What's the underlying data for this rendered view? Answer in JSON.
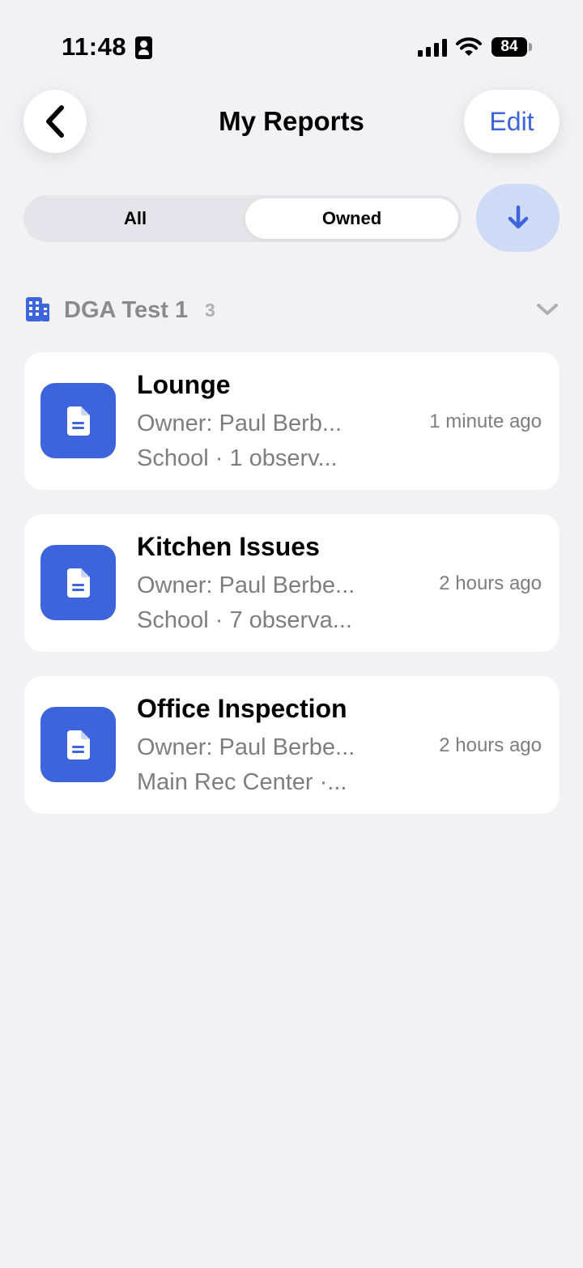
{
  "status_bar": {
    "time": "11:48",
    "battery": "84",
    "icons": [
      "id-card-icon",
      "signal-icon",
      "wifi-icon",
      "battery-icon"
    ]
  },
  "nav": {
    "title": "My Reports",
    "edit_label": "Edit",
    "back_icon": "chevron-left-icon"
  },
  "filter": {
    "segments": [
      {
        "label": "All",
        "selected": false
      },
      {
        "label": "Owned",
        "selected": true
      }
    ],
    "sort_icon": "arrow-down-icon"
  },
  "group": {
    "icon": "building-icon",
    "title": "DGA Test 1",
    "count": "3",
    "chevron": "chevron-down-icon"
  },
  "reports": [
    {
      "title": "Lounge",
      "owner": "Owner: Paul Berb...",
      "meta": "School · 1 observ...",
      "time": "1 minute ago",
      "icon": "document-icon"
    },
    {
      "title": "Kitchen Issues",
      "owner": "Owner: Paul Berbe...",
      "meta": "School · 7 observa...",
      "time": "2 hours ago",
      "icon": "document-icon"
    },
    {
      "title": "Office Inspection",
      "owner": "Owner: Paul Berbe...",
      "meta": "Main Rec Center ·...",
      "time": "2 hours ago",
      "icon": "document-icon"
    }
  ],
  "colors": {
    "accent": "#3d63dd",
    "background": "#f1f1f6",
    "sort_button": "#cfdaf4",
    "secondary_text": "#7d7d82"
  }
}
